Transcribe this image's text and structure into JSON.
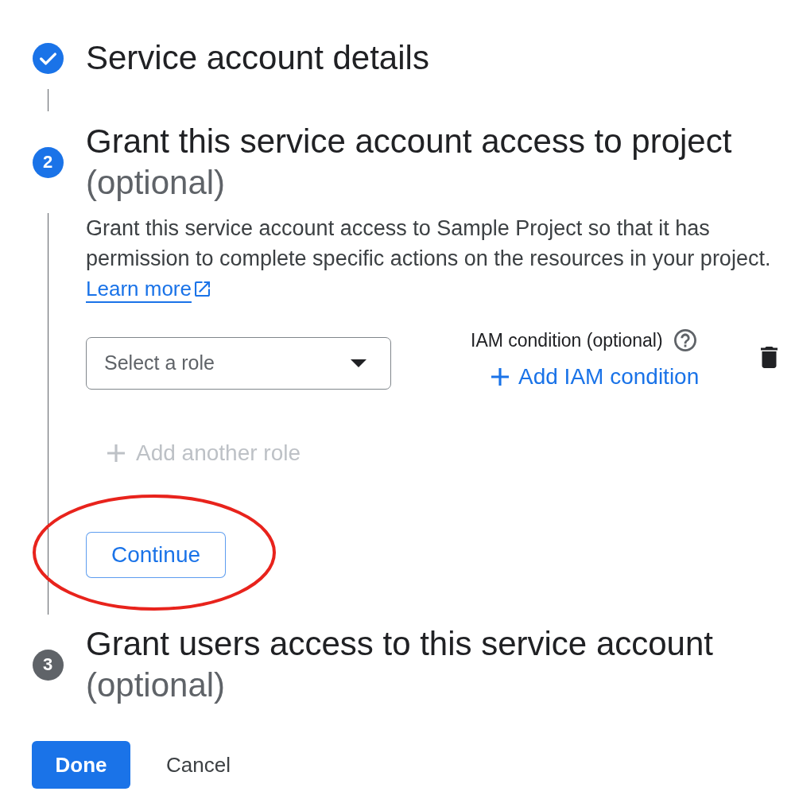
{
  "steps": [
    {
      "kind": "done",
      "title": "Service account details"
    },
    {
      "kind": "active",
      "number": "2",
      "title": "Grant this service account access to project",
      "subtitle": "(optional)",
      "body": {
        "description": "Grant this service account access to Sample Project so that it has permission to complete specific actions on the resources in your project.",
        "learn_more": {
          "label": "Learn more"
        },
        "role_select": {
          "placeholder": "Select a role"
        },
        "iam_condition": {
          "label": "IAM condition (optional)",
          "add_button": {
            "label": "Add IAM condition"
          }
        },
        "add_role": {
          "label": "Add another role",
          "disabled": true
        },
        "continue_button": {
          "label": "Continue",
          "circled": true
        }
      }
    },
    {
      "kind": "pending",
      "number": "3",
      "title": "Grant users access to this service account",
      "subtitle": "(optional)"
    }
  ],
  "actions": [
    {
      "kind": "primary",
      "label": "Done"
    },
    {
      "kind": "text",
      "label": "Cancel"
    }
  ]
}
